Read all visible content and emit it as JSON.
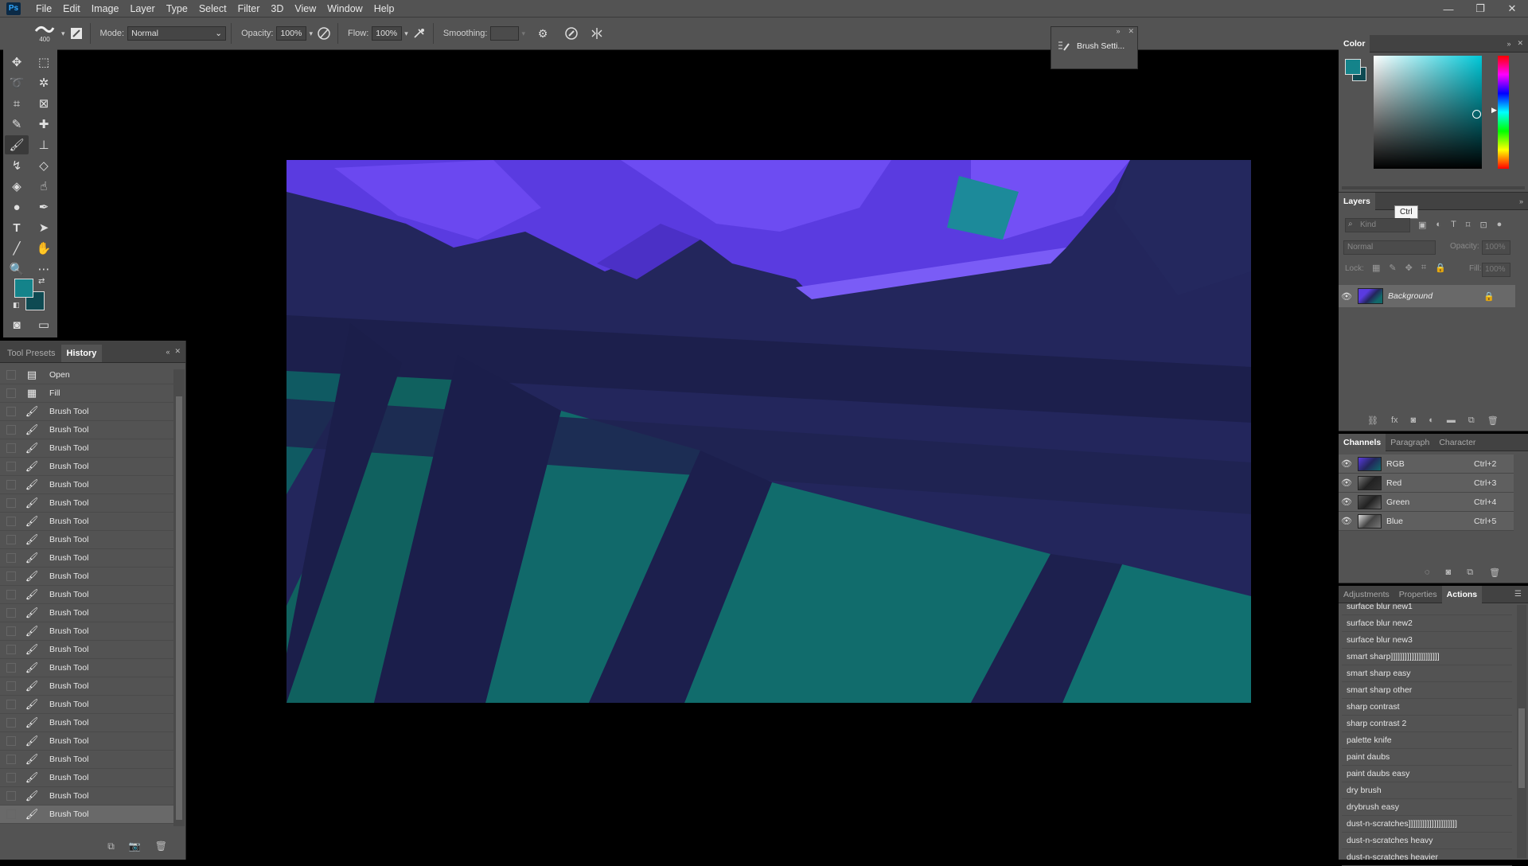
{
  "menu": {
    "logo": "Ps",
    "items": [
      "File",
      "Edit",
      "Image",
      "Layer",
      "Type",
      "Select",
      "Filter",
      "3D",
      "View",
      "Window",
      "Help"
    ],
    "window_controls": [
      "—",
      "❐",
      "✕"
    ]
  },
  "options": {
    "brush_size": "400",
    "mode_label": "Mode:",
    "mode_value": "Normal",
    "opacity_label": "Opacity:",
    "opacity_value": "100%",
    "flow_label": "Flow:",
    "flow_value": "100%",
    "smoothing_label": "Smoothing:",
    "smoothing_value": ""
  },
  "brush_settings": {
    "label": "Brush Setti..."
  },
  "colors": {
    "foreground": "#14838a",
    "background": "#0e4a52",
    "accent": "#31a8ff"
  },
  "history": {
    "tabs": [
      "Tool Presets",
      "History"
    ],
    "active_tab": "History",
    "items": [
      {
        "icon": "document-icon",
        "label": "Open"
      },
      {
        "icon": "fill-icon",
        "label": "Fill"
      },
      {
        "icon": "brush-icon",
        "label": "Brush Tool"
      },
      {
        "icon": "brush-icon",
        "label": "Brush Tool"
      },
      {
        "icon": "brush-icon",
        "label": "Brush Tool"
      },
      {
        "icon": "brush-icon",
        "label": "Brush Tool"
      },
      {
        "icon": "brush-icon",
        "label": "Brush Tool"
      },
      {
        "icon": "brush-icon",
        "label": "Brush Tool"
      },
      {
        "icon": "brush-icon",
        "label": "Brush Tool"
      },
      {
        "icon": "brush-icon",
        "label": "Brush Tool"
      },
      {
        "icon": "brush-icon",
        "label": "Brush Tool"
      },
      {
        "icon": "brush-icon",
        "label": "Brush Tool"
      },
      {
        "icon": "brush-icon",
        "label": "Brush Tool"
      },
      {
        "icon": "brush-icon",
        "label": "Brush Tool"
      },
      {
        "icon": "brush-icon",
        "label": "Brush Tool"
      },
      {
        "icon": "brush-icon",
        "label": "Brush Tool"
      },
      {
        "icon": "brush-icon",
        "label": "Brush Tool"
      },
      {
        "icon": "brush-icon",
        "label": "Brush Tool"
      },
      {
        "icon": "brush-icon",
        "label": "Brush Tool"
      },
      {
        "icon": "brush-icon",
        "label": "Brush Tool"
      },
      {
        "icon": "brush-icon",
        "label": "Brush Tool"
      },
      {
        "icon": "brush-icon",
        "label": "Brush Tool"
      },
      {
        "icon": "brush-icon",
        "label": "Brush Tool"
      },
      {
        "icon": "brush-icon",
        "label": "Brush Tool"
      },
      {
        "icon": "brush-icon",
        "label": "Brush Tool"
      }
    ]
  },
  "color_panel": {
    "title": "Color"
  },
  "layers": {
    "title": "Layers",
    "search_placeholder": "Kind",
    "blend_mode": "Normal",
    "opacity_label": "Opacity:",
    "opacity_value": "100%",
    "lock_label": "Lock:",
    "fill_label": "Fill:",
    "fill_value": "100%",
    "layer_name": "Background",
    "tooltip": "Ctrl"
  },
  "channels": {
    "tabs": [
      "Channels",
      "Paragraph",
      "Character"
    ],
    "rows": [
      {
        "name": "RGB",
        "key": "Ctrl+2"
      },
      {
        "name": "Red",
        "key": "Ctrl+3"
      },
      {
        "name": "Green",
        "key": "Ctrl+4"
      },
      {
        "name": "Blue",
        "key": "Ctrl+5"
      }
    ]
  },
  "actions": {
    "tabs": [
      "Adjustments",
      "Properties",
      "Actions"
    ],
    "items": [
      "surface blur new1",
      "surface blur new2",
      "surface blur new3",
      "smart sharp]]]]]]]]]]]]]]]]]]]]]",
      "smart sharp easy",
      "smart sharp other",
      "sharp contrast",
      "sharp contrast 2",
      "palette knife",
      "paint daubs",
      "paint daubs easy",
      "dry brush",
      "drybrush easy",
      "dust-n-scratches]]]]]]]]]]]]]]]]]]]]]",
      "dust-n-scratches heavy",
      "dust-n-scratches heavier"
    ]
  }
}
